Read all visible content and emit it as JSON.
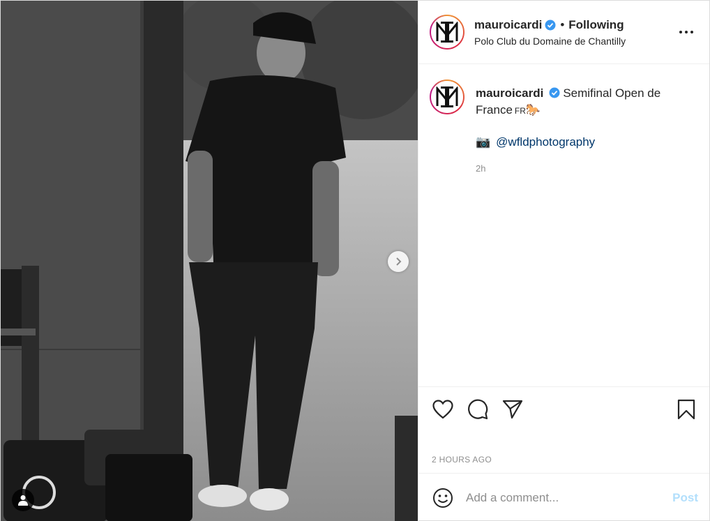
{
  "header": {
    "username": "mauroicardi",
    "separator": "•",
    "follow_status": "Following",
    "location": "Polo Club du Domaine de Chantilly",
    "avatar_monogram": "MI"
  },
  "caption": {
    "username": "mauroicardi",
    "text": "Semifinal Open de France",
    "flag": "FR",
    "emoji": "🐎",
    "camera_emoji": "📷",
    "mention": "@wfldphotography",
    "time_ago": "2h"
  },
  "actions": {
    "like_icon": "heart-icon",
    "comment_icon": "comment-icon",
    "share_icon": "paper-plane-icon",
    "save_icon": "bookmark-icon"
  },
  "posted_time": "2 HOURS AGO",
  "comment_box": {
    "placeholder": "Add a comment...",
    "post_label": "Post"
  },
  "colors": {
    "verified": "#3897f0",
    "mention": "#00376b",
    "post_button_disabled": "#b2dffc",
    "muted_text": "#8e8e8e"
  },
  "media": {
    "style": "black-and-white photo",
    "has_next": true,
    "has_user_tags": true
  }
}
